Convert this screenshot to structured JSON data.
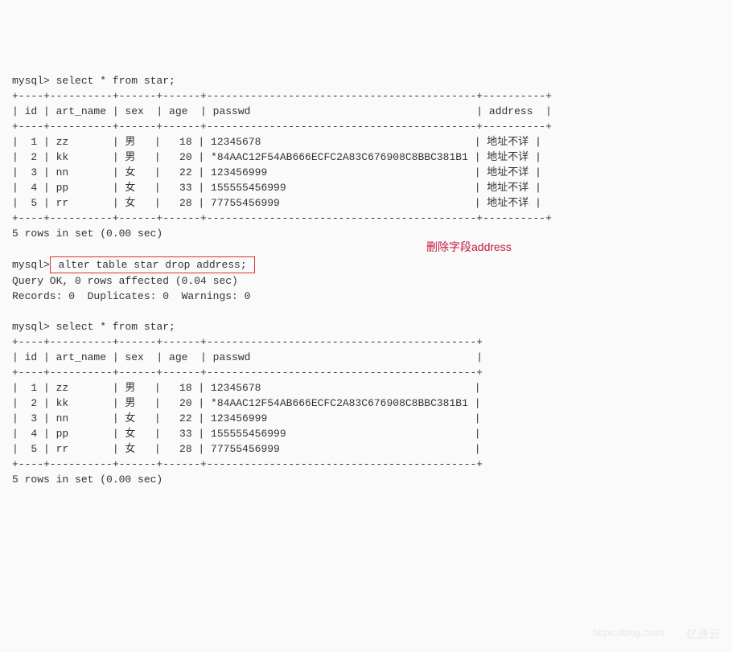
{
  "prompt": "mysql>",
  "query1": "select * from star;",
  "sep1_full": "+----+----------+------+------+-------------------------------------------+----------+",
  "header_full": "| id | art_name | sex  | age  | passwd                                    | address  |",
  "table1": {
    "headers": [
      "id",
      "art_name",
      "sex",
      "age",
      "passwd",
      "address"
    ],
    "rows": [
      {
        "id": "1",
        "art_name": "zz",
        "sex": "男",
        "age": "18",
        "passwd": "12345678",
        "address": "地址不详"
      },
      {
        "id": "2",
        "art_name": "kk",
        "sex": "男",
        "age": "20",
        "passwd": "*84AAC12F54AB666ECFC2A83C676908C8BBC381B1",
        "address": "地址不详"
      },
      {
        "id": "3",
        "art_name": "nn",
        "sex": "女",
        "age": "22",
        "passwd": "123456999",
        "address": "地址不详"
      },
      {
        "id": "4",
        "art_name": "pp",
        "sex": "女",
        "age": "33",
        "passwd": "155555456999",
        "address": "地址不详"
      },
      {
        "id": "5",
        "art_name": "rr",
        "sex": "女",
        "age": "28",
        "passwd": "77755456999",
        "address": "地址不详"
      }
    ]
  },
  "rows_msg1": "5 rows in set (0.00 sec)",
  "query2": " alter table star drop address; ",
  "query2_result1": "Query OK, 0 rows affected (0.04 sec)",
  "query2_result2": "Records: 0  Duplicates: 0  Warnings: 0",
  "annotation": "删除字段address",
  "query3": "select * from star;",
  "sep2_short": "+----+----------+------+------+-------------------------------------------+",
  "header_short": "| id | art_name | sex  | age  | passwd                                    |",
  "table2": {
    "headers": [
      "id",
      "art_name",
      "sex",
      "age",
      "passwd"
    ],
    "rows": [
      {
        "id": "1",
        "art_name": "zz",
        "sex": "男",
        "age": "18",
        "passwd": "12345678"
      },
      {
        "id": "2",
        "art_name": "kk",
        "sex": "男",
        "age": "20",
        "passwd": "*84AAC12F54AB666ECFC2A83C676908C8BBC381B1"
      },
      {
        "id": "3",
        "art_name": "nn",
        "sex": "女",
        "age": "22",
        "passwd": "123456999"
      },
      {
        "id": "4",
        "art_name": "pp",
        "sex": "女",
        "age": "33",
        "passwd": "155555456999"
      },
      {
        "id": "5",
        "art_name": "rr",
        "sex": "女",
        "age": "28",
        "passwd": "77755456999"
      }
    ]
  },
  "rows_msg2": "5 rows in set (0.00 sec)",
  "watermark_text": "https://blog.csdn",
  "watermark_logo": "亿速云"
}
